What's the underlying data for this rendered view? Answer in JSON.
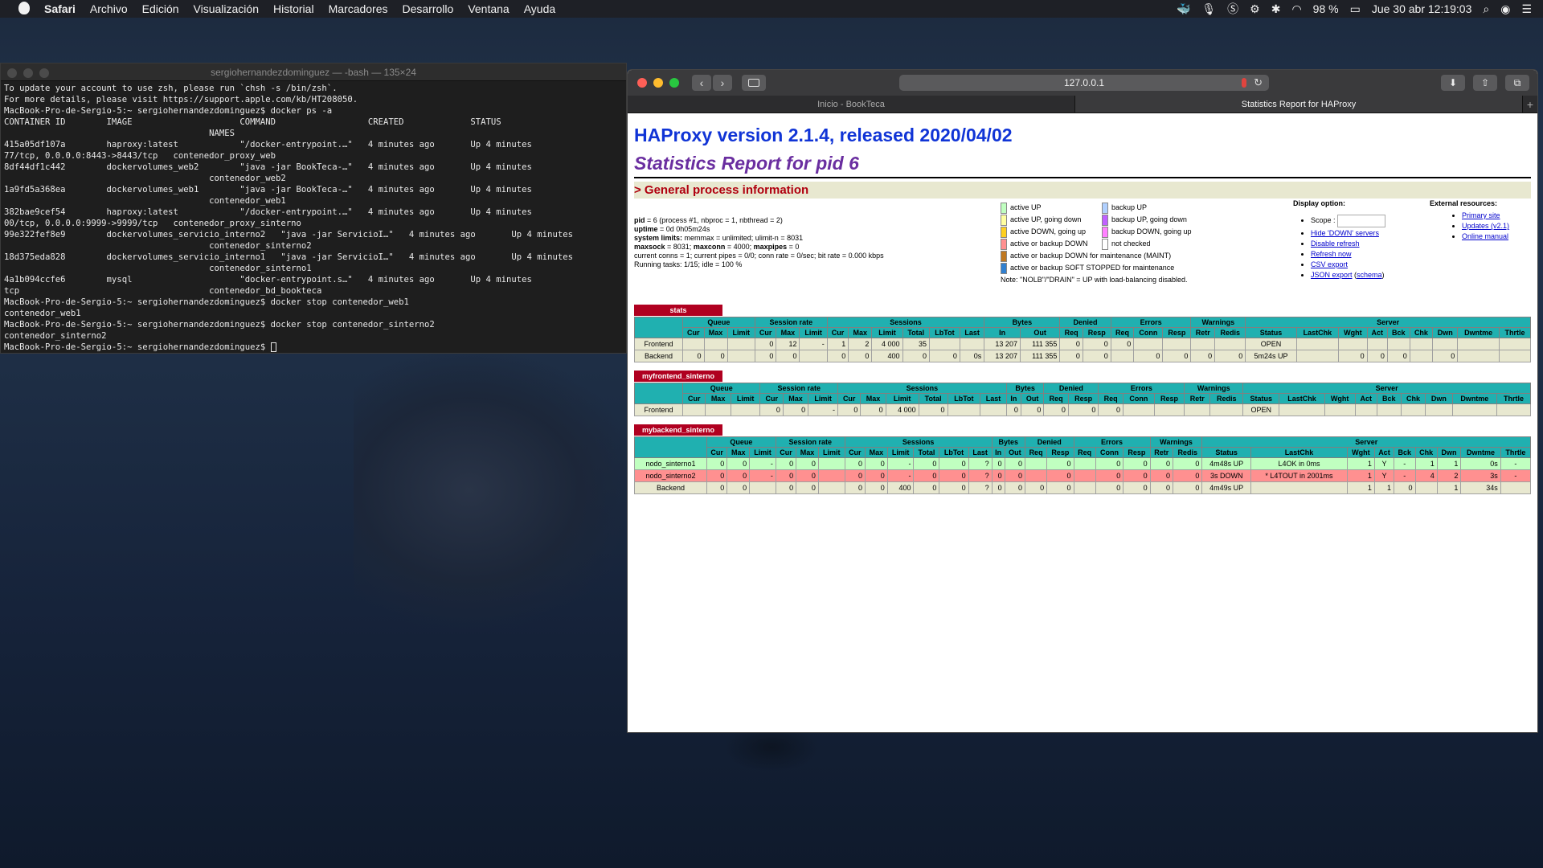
{
  "menubar": {
    "app": "Safari",
    "items": [
      "Archivo",
      "Edición",
      "Visualización",
      "Historial",
      "Marcadores",
      "Desarrollo",
      "Ventana",
      "Ayuda"
    ],
    "battery": "98 %",
    "clock": "Jue 30 abr  12:19:03"
  },
  "terminal": {
    "title": "sergiohernandezdominguez — -bash — 135×24",
    "lines": [
      "To update your account to use zsh, please run `chsh -s /bin/zsh`.",
      "For more details, please visit https://support.apple.com/kb/HT208050.",
      "MacBook-Pro-de-Sergio-5:~ sergiohernandezdominguez$ docker ps -a",
      "CONTAINER ID        IMAGE                     COMMAND                  CREATED             STATUS",
      "                                        NAMES",
      "415a05df107a        haproxy:latest            \"/docker-entrypoint.…\"   4 minutes ago       Up 4 minutes",
      "77/tcp, 0.0.0.0:8443->8443/tcp   contenedor_proxy_web",
      "8df44df1c442        dockervolumes_web2        \"java -jar BookTeca-…\"   4 minutes ago       Up 4 minutes",
      "                                        contenedor_web2",
      "1a9fd5a368ea        dockervolumes_web1        \"java -jar BookTeca-…\"   4 minutes ago       Up 4 minutes",
      "                                        contenedor_web1",
      "382bae9cef54        haproxy:latest            \"/docker-entrypoint.…\"   4 minutes ago       Up 4 minutes",
      "00/tcp, 0.0.0.0:9999->9999/tcp   contenedor_proxy_sinterno",
      "99e322fef8e9        dockervolumes_servicio_interno2   \"java -jar ServicioI…\"   4 minutes ago       Up 4 minutes",
      "                                        contenedor_sinterno2",
      "18d375eda828        dockervolumes_servicio_interno1   \"java -jar ServicioI…\"   4 minutes ago       Up 4 minutes",
      "                                        contenedor_sinterno1",
      "4a1b094ccfe6        mysql                     \"docker-entrypoint.s…\"   4 minutes ago       Up 4 minutes",
      "tcp                                     contenedor_bd_bookteca",
      "MacBook-Pro-de-Sergio-5:~ sergiohernandezdominguez$ docker stop contenedor_web1",
      "contenedor_web1",
      "MacBook-Pro-de-Sergio-5:~ sergiohernandezdominguez$ docker stop contenedor_sinterno2",
      "contenedor_sinterno2",
      "MacBook-Pro-de-Sergio-5:~ sergiohernandezdominguez$ "
    ]
  },
  "safari": {
    "url": "127.0.0.1",
    "tabs": [
      "Inicio - BookTeca",
      "Statistics Report for HAProxy"
    ]
  },
  "haproxy": {
    "version_title": "HAProxy version 2.1.4, released 2020/04/02",
    "report_title": "Statistics Report for pid 6",
    "gpi_title": "> General process information",
    "proc_lines": [
      "pid = 6 (process #1, nbproc = 1, nbthread = 2)",
      "uptime = 0d 0h05m24s",
      "system limits: memmax = unlimited; ulimit-n = 8031",
      "maxsock = 8031; maxconn = 4000; maxpipes = 0",
      "current conns = 1; current pipes = 0/0; conn rate = 0/sec; bit rate = 0.000 kbps",
      "Running tasks: 1/15; idle = 100 %"
    ],
    "legend_left": [
      {
        "label": "active UP",
        "color": "#c0ffc0"
      },
      {
        "label": "active UP, going down",
        "color": "#ffffa0"
      },
      {
        "label": "active DOWN, going up",
        "color": "#ffd020"
      },
      {
        "label": "active or backup DOWN",
        "color": "#ff9090"
      },
      {
        "label": "active or backup DOWN for maintenance (MAINT)",
        "color": "#c07820"
      },
      {
        "label": "active or backup SOFT STOPPED for maintenance",
        "color": "#3080d0"
      }
    ],
    "legend_right": [
      {
        "label": "backup UP",
        "color": "#b0d0ff"
      },
      {
        "label": "backup UP, going down",
        "color": "#c060ff"
      },
      {
        "label": "backup DOWN, going up",
        "color": "#ff80ff"
      },
      {
        "label": "not checked",
        "color": "#ffffff"
      }
    ],
    "legend_note": "Note: \"NOLB\"/\"DRAIN\" = UP with load-balancing disabled.",
    "display_option": {
      "title": "Display option:",
      "scope_label": "Scope :",
      "links": [
        "Hide 'DOWN' servers",
        "Disable refresh",
        "Refresh now",
        "CSV export",
        "JSON export"
      ],
      "schema_link": "schema"
    },
    "external": {
      "title": "External resources:",
      "links": [
        "Primary site",
        "Updates (v2.1)",
        "Online manual"
      ]
    },
    "sections": {
      "stats": "stats",
      "frontend": "myfrontend_sinterno",
      "backend": "mybackend_sinterno"
    }
  }
}
